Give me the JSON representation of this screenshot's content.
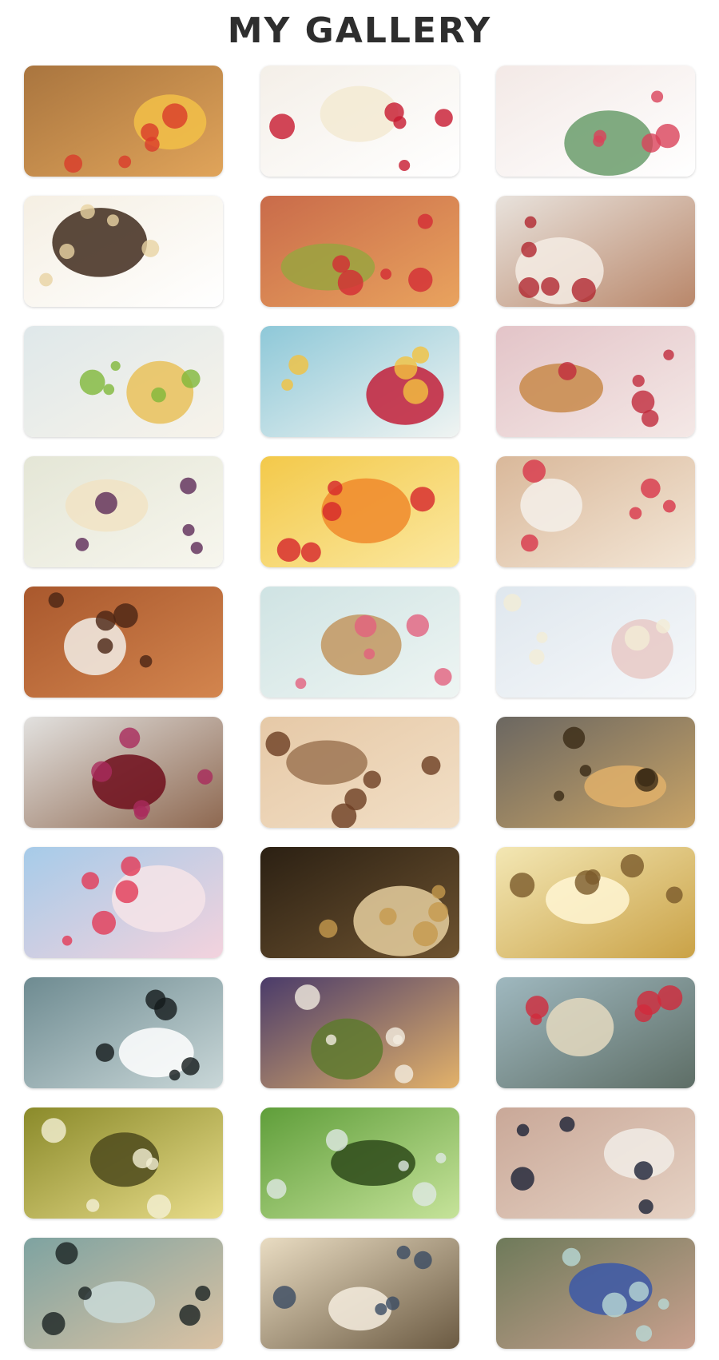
{
  "header": {
    "title": "MY GALLERY"
  },
  "gallery": {
    "items": [
      {
        "icon": "bruschetta-image",
        "c1": "#a9753f",
        "c2": "#e0a45a",
        "accent": "#d93b2b",
        "accent2": "#f2c048"
      },
      {
        "icon": "ice-cream-raspberries-image",
        "c1": "#f4efe8",
        "c2": "#ffffff",
        "accent": "#c7192f",
        "accent2": "#f3ead2"
      },
      {
        "icon": "sorbet-cups-image",
        "c1": "#f3e9e6",
        "c2": "#ffffff",
        "accent": "#d9425a",
        "accent2": "#6a9c6b"
      },
      {
        "icon": "vanilla-ice-cream-image",
        "c1": "#f5efe3",
        "c2": "#ffffff",
        "accent": "#e9d3a3",
        "accent2": "#3f2a1c"
      },
      {
        "icon": "macarons-image",
        "c1": "#c96b4a",
        "c2": "#e9a35e",
        "accent": "#d32c35",
        "accent2": "#9aa340"
      },
      {
        "icon": "victoria-sponge-cake-image",
        "c1": "#e8e2dc",
        "c2": "#b9876a",
        "accent": "#b0272f",
        "accent2": "#f4ece4"
      },
      {
        "icon": "ice-cream-limes-image",
        "c1": "#dfe8ea",
        "c2": "#f7f3ea",
        "accent": "#7fb83a",
        "accent2": "#e9c15a"
      },
      {
        "icon": "lemonade-glasses-image",
        "c1": "#8ec8d8",
        "c2": "#f0f4f2",
        "accent": "#f2c23e",
        "accent2": "#c2203a"
      },
      {
        "icon": "strudel-strawberries-image",
        "c1": "#e3c4c8",
        "c2": "#f4e8e6",
        "accent": "#c12b3c",
        "accent2": "#c88a4a"
      },
      {
        "icon": "berry-cheesecake-image",
        "c1": "#e4e6d6",
        "c2": "#f7f6ee",
        "accent": "#5c2a58",
        "accent2": "#f1e3c4"
      },
      {
        "icon": "fruit-skewers-image",
        "c1": "#f3c94a",
        "c2": "#fbe8a0",
        "accent": "#d6262c",
        "accent2": "#f08a2c"
      },
      {
        "icon": "cupcake-teacup-image",
        "c1": "#d9b89a",
        "c2": "#f3e6d6",
        "accent": "#d8364a",
        "accent2": "#f4f0ea"
      },
      {
        "icon": "chocolate-dessert-image",
        "c1": "#a9582d",
        "c2": "#d3854e",
        "accent": "#4a2414",
        "accent2": "#f2ede6"
      },
      {
        "icon": "rose-cupcakes-image",
        "c1": "#cfe3e3",
        "c2": "#eef5f3",
        "accent": "#e2607e",
        "accent2": "#c29660"
      },
      {
        "icon": "coconut-cake-image",
        "c1": "#dfe7ee",
        "c2": "#f6f8fa",
        "accent": "#f3ecd6",
        "accent2": "#e8c9c6"
      },
      {
        "icon": "cherry-ice-cream-cones-image",
        "c1": "#e2e1df",
        "c2": "#8e6850",
        "accent": "#a92b5c",
        "accent2": "#6e0d1b"
      },
      {
        "icon": "chocolate-ice-cream-coffee-beans-image",
        "c1": "#e6c9a7",
        "c2": "#f2dfc6",
        "accent": "#6b3d22",
        "accent2": "#9e7553"
      },
      {
        "icon": "westminster-lamp-image",
        "c1": "#6b6761",
        "c2": "#c8a366",
        "accent": "#3a2b15",
        "accent2": "#e0b06a"
      },
      {
        "icon": "strawberry-ice-cream-image",
        "c1": "#a6cbe9",
        "c2": "#f3d2dd",
        "accent": "#e23a56",
        "accent2": "#f6e4e8"
      },
      {
        "icon": "latte-coffee-image",
        "c1": "#2b2013",
        "c2": "#6e5330",
        "accent": "#c69a4e",
        "accent2": "#e6cf9f"
      },
      {
        "icon": "bicycle-wheat-field-image",
        "c1": "#f3e7b4",
        "c2": "#caa247",
        "accent": "#7b5a2a",
        "accent2": "#fff6d4"
      },
      {
        "icon": "snowy-street-lamp-image",
        "c1": "#6e8b91",
        "c2": "#c9d7d8",
        "accent": "#141a1c",
        "accent2": "#ffffff"
      },
      {
        "icon": "mug-bokeh-image",
        "c1": "#4a3b6a",
        "c2": "#e3b26a",
        "accent": "#f2ece0",
        "accent2": "#5e7a2e"
      },
      {
        "icon": "flower-bottle-puddle-image",
        "c1": "#9fb8bf",
        "c2": "#5e6e66",
        "accent": "#d12a3c",
        "accent2": "#e4d9c0"
      },
      {
        "icon": "hanging-bottles-image",
        "c1": "#8a8a2a",
        "c2": "#e8dc8a",
        "accent": "#f4f0d4",
        "accent2": "#4e4a1c"
      },
      {
        "icon": "glass-jar-grass-image",
        "c1": "#5f9e3a",
        "c2": "#c6e39a",
        "accent": "#dfe9e4",
        "accent2": "#2e4a1a"
      },
      {
        "icon": "hanging-bottle-image",
        "c1": "#c9a898",
        "c2": "#e6d2c4",
        "accent": "#1b2236",
        "accent2": "#f1ece6"
      },
      {
        "icon": "park-bench-image",
        "c1": "#7ea3a1",
        "c2": "#dbc2a3",
        "accent": "#1a2323",
        "accent2": "#c9d9d7"
      },
      {
        "icon": "bicycles-field-image",
        "c1": "#e9dcc2",
        "c2": "#6b5a42",
        "accent": "#3a4b63",
        "accent2": "#f4ecde"
      },
      {
        "icon": "star-jar-image",
        "c1": "#6e7a5a",
        "c2": "#c9a08e",
        "accent": "#b8d8d6",
        "accent2": "#3b58a8"
      }
    ]
  }
}
